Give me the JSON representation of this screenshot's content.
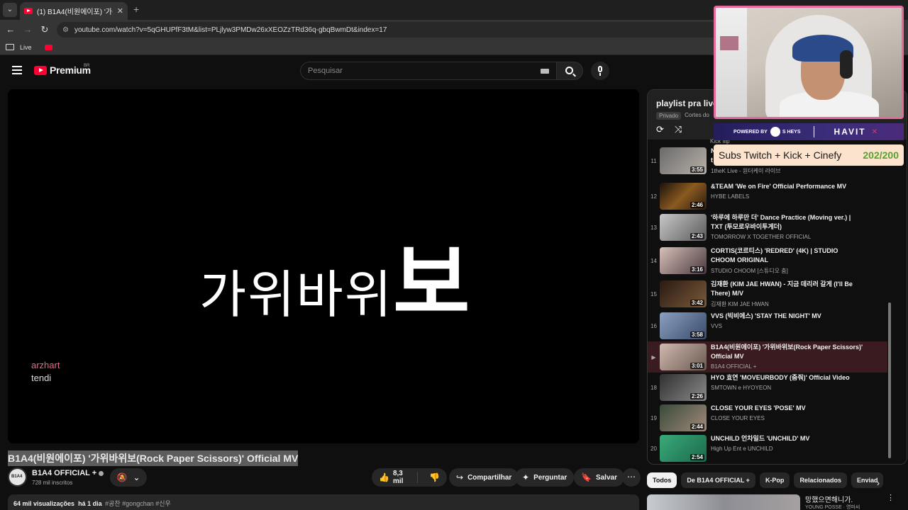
{
  "browser": {
    "tab_title": "(1) B1A4(비원에이포) '가위바위",
    "url": "youtube.com/watch?v=5qGHUPfF3tM&list=PLjlyw3PMDw26xXEOZzTRd36q-gbqBwmDt&index=17",
    "bookmark_live": "Live"
  },
  "masthead": {
    "logo": "Premium",
    "country": "BR",
    "search_placeholder": "Pesquisar"
  },
  "player": {
    "art_text": "가위바위",
    "art_text_big": "보",
    "credit_1": "arzhart",
    "credit_2": "tendi"
  },
  "video": {
    "title": "B1A4(비원에이포) '가위바위보(Rock Paper Scissors)' Official MV",
    "channel": "B1A4 OFFICIAL +",
    "subscribers": "728 mil inscritos",
    "likes": "8,3 mil",
    "share": "Compartilhar",
    "ask": "Perguntar",
    "save": "Salvar",
    "views": "64 mil visualizações",
    "age": "há 1 dia",
    "tags": "#공찬 #gongchan #신우"
  },
  "playlist": {
    "title": "playlist pra live",
    "privacy": "Privado",
    "owner": "Cortes do",
    "partial_top_channel": "Kick flip",
    "items": [
      {
        "index": "11",
        "title": "N",
        "line2": "t",
        "channel": "1theK Live - 원더케이 라이브",
        "duration": "3:55"
      },
      {
        "index": "12",
        "title": "&TEAM 'We on Fire' Official Performance MV",
        "channel": "HYBE LABELS",
        "duration": "2:46"
      },
      {
        "index": "13",
        "title": "'하루에 하루만 더' Dance Practice (Moving ver.) | TXT (투모로우바이투게더)",
        "channel": "TOMORROW X TOGETHER OFFICIAL",
        "duration": "2:43"
      },
      {
        "index": "14",
        "title": "CORTIS(코르티스) 'REDRED' (4K) | STUDIO CHOOM ORIGINAL",
        "channel": "STUDIO CHOOM [스튜디오 춤]",
        "duration": "3:16"
      },
      {
        "index": "15",
        "title": "김재환 (KIM JAE HWAN) - 지금 데리러 갈게 (I'll Be There) M/V",
        "channel": "김재환 KIM JAE HWAN",
        "duration": "3:42"
      },
      {
        "index": "16",
        "title": "VVS (빅비에스) 'STAY THE NIGHT' MV",
        "channel": "VVS",
        "duration": "3:58"
      },
      {
        "index": "▶",
        "title": "B1A4(비원에이포) '가위바위보(Rock Paper Scissors)' Official MV",
        "channel": "B1A4 OFFICIAL +",
        "duration": "3:01"
      },
      {
        "index": "18",
        "title": "HYO 효연 'MOVEURBODY (줌줘)' Official Video",
        "channel": "SMTOWN e HYOYEON",
        "duration": "2:26"
      },
      {
        "index": "19",
        "title": "CLOSE YOUR EYES 'POSE' MV",
        "channel": "CLOSE YOUR EYES",
        "duration": "2:44"
      },
      {
        "index": "20",
        "title": "UNCHILD 언차일드 'UNCHILD' MV",
        "channel": "High Up Ent e UNCHILD",
        "duration": "2:54"
      }
    ]
  },
  "chips": [
    "Todos",
    "De B1A4 OFFICIAL +",
    "K-Pop",
    "Relacionados",
    "Enviad"
  ],
  "recommendation": {
    "title": "망했으면해니가.",
    "channel": "YOUNG POSSE · 영파씨"
  },
  "overlay": {
    "powered_by": "POWERED BY",
    "sponsor_1": "S HEYS",
    "sponsor_2": "HAVIT",
    "subs_goal_label": "Subs Twitch + Kick + Cinefy",
    "subs_goal_count": "202/200"
  },
  "colors": {
    "accent": "#ff0033",
    "active_row": "#3a1c20",
    "webcam_border": "#e66a9c",
    "goal_count": "#5aa02c"
  }
}
